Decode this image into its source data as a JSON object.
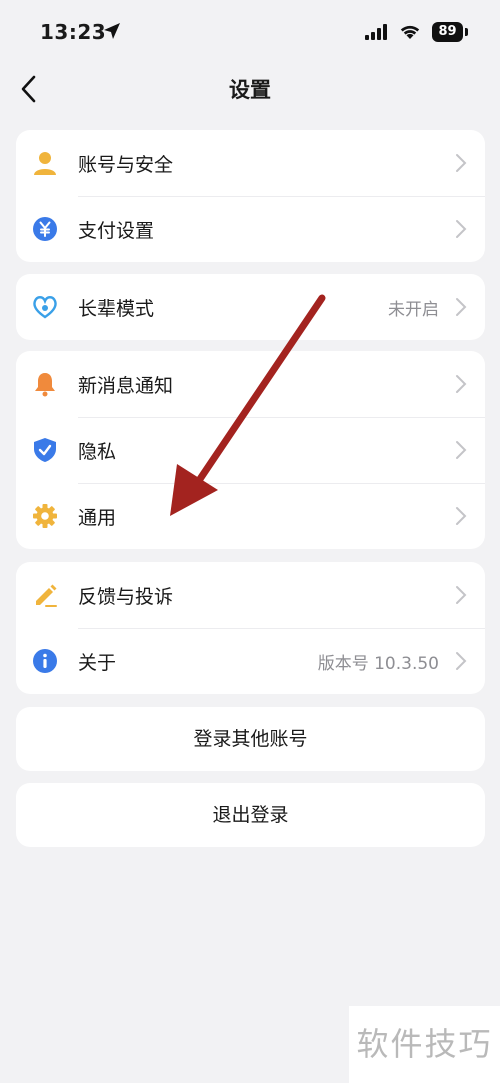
{
  "status_bar": {
    "time": "13:23",
    "battery": "89"
  },
  "nav": {
    "title": "设置"
  },
  "groups": {
    "account": [
      {
        "label": "账号与安全"
      },
      {
        "label": "支付设置"
      }
    ],
    "elder": [
      {
        "label": "长辈模式",
        "value": "未开启"
      }
    ],
    "general": [
      {
        "label": "新消息通知"
      },
      {
        "label": "隐私"
      },
      {
        "label": "通用"
      }
    ],
    "about": [
      {
        "label": "反馈与投诉"
      },
      {
        "label": "关于",
        "value": "版本号 10.3.50"
      }
    ]
  },
  "buttons": {
    "switch_account": "登录其他账号",
    "logout": "退出登录"
  },
  "watermark": "软件技巧",
  "colors": {
    "user_icon": "#f0b43c",
    "pay_icon": "#3a7ae8",
    "elder_icon": "#3aa0e8",
    "bell_icon": "#f08a3c",
    "privacy_icon": "#3a7ae8",
    "gear_icon": "#f0b43c",
    "feedback_icon": "#f0b43c",
    "info_icon": "#3a7ae8",
    "annotation_arrow": "#a3231f"
  }
}
